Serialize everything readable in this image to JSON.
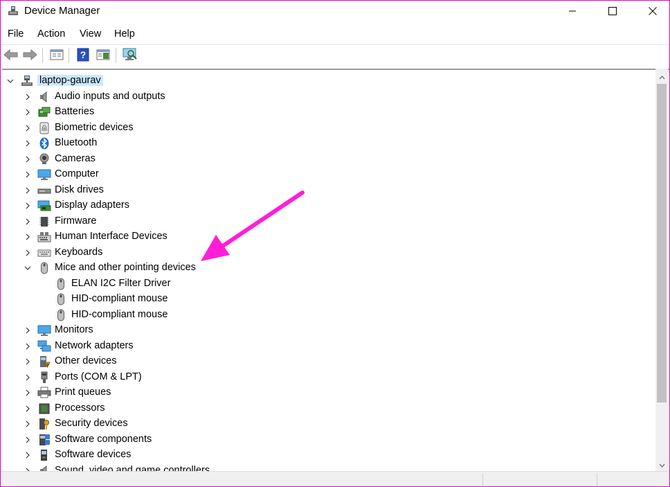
{
  "window": {
    "title": "Device Manager",
    "icons": {
      "app": "device-manager-icon",
      "minimize": "minimize-icon",
      "maximize": "maximize-icon",
      "close": "close-icon"
    }
  },
  "menu": [
    {
      "label": "File"
    },
    {
      "label": "Action"
    },
    {
      "label": "View"
    },
    {
      "label": "Help"
    }
  ],
  "toolbar": {
    "buttons": [
      "back-arrow-icon",
      "forward-arrow-icon",
      "properties-icon",
      "help-icon",
      "show-hide-tree-icon",
      "scan-hardware-icon"
    ]
  },
  "tree": {
    "root": {
      "label": "laptop-gaurav",
      "icon": "computer-network-icon",
      "expanded": true
    },
    "categories": [
      {
        "label": "Audio inputs and outputs",
        "icon": "speaker-icon"
      },
      {
        "label": "Batteries",
        "icon": "battery-icon"
      },
      {
        "label": "Biometric devices",
        "icon": "fingerprint-icon"
      },
      {
        "label": "Bluetooth",
        "icon": "bluetooth-icon"
      },
      {
        "label": "Cameras",
        "icon": "camera-icon"
      },
      {
        "label": "Computer",
        "icon": "monitor-icon"
      },
      {
        "label": "Disk drives",
        "icon": "disk-drive-icon"
      },
      {
        "label": "Display adapters",
        "icon": "display-adapter-icon"
      },
      {
        "label": "Firmware",
        "icon": "chip-icon"
      },
      {
        "label": "Human Interface Devices",
        "icon": "hid-icon"
      },
      {
        "label": "Keyboards",
        "icon": "keyboard-icon"
      },
      {
        "label": "Mice and other pointing devices",
        "icon": "mouse-icon",
        "expanded": true,
        "children": [
          {
            "label": "ELAN I2C Filter Driver",
            "icon": "mouse-icon"
          },
          {
            "label": "HID-compliant mouse",
            "icon": "mouse-icon"
          },
          {
            "label": "HID-compliant mouse",
            "icon": "mouse-icon"
          }
        ]
      },
      {
        "label": "Monitors",
        "icon": "monitor-icon"
      },
      {
        "label": "Network adapters",
        "icon": "network-icon"
      },
      {
        "label": "Other devices",
        "icon": "unknown-device-icon"
      },
      {
        "label": "Ports (COM & LPT)",
        "icon": "port-icon"
      },
      {
        "label": "Print queues",
        "icon": "printer-icon"
      },
      {
        "label": "Processors",
        "icon": "processor-icon"
      },
      {
        "label": "Security devices",
        "icon": "security-key-icon"
      },
      {
        "label": "Software components",
        "icon": "software-component-icon"
      },
      {
        "label": "Software devices",
        "icon": "software-device-icon"
      },
      {
        "label": "Sound, video and game controllers",
        "icon": "speaker-icon"
      }
    ]
  },
  "annotation": {
    "type": "arrow",
    "color": "#ff1ed7",
    "points_to": "Mice and other pointing devices"
  },
  "colors": {
    "window_border": "#e000c8",
    "selection": "#cce8ff",
    "annotation_arrow": "#ff1ed7"
  }
}
